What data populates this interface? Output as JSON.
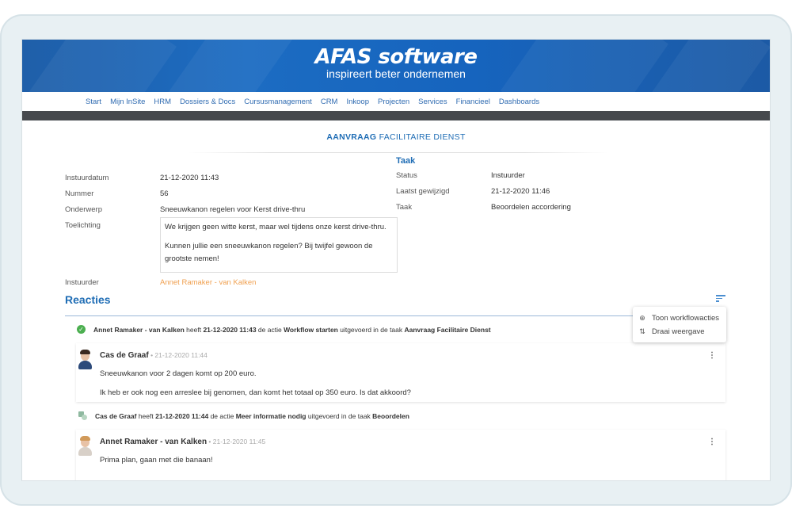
{
  "brand": {
    "name": "AFAS software",
    "tagline": "inspireert beter ondernemen",
    "colors": {
      "primary": "#1c6cc2",
      "nav_text": "#2f6bb1",
      "dark_bar": "#46494d",
      "link_orange": "#f0a050",
      "success": "#4caf50"
    }
  },
  "nav": {
    "items": [
      "Start",
      "Mijn InSite",
      "HRM",
      "Dossiers & Docs",
      "Cursusmanagement",
      "CRM",
      "Inkoop",
      "Projecten",
      "Services",
      "Financieel",
      "Dashboards"
    ]
  },
  "page": {
    "title_bold": "AANVRAAG",
    "title_rest": " FACILITAIRE DIENST"
  },
  "form": {
    "instuurdatum_label": "Instuurdatum",
    "instuurdatum_value": "21-12-2020 11:43",
    "nummer_label": "Nummer",
    "nummer_value": "56",
    "onderwerp_label": "Onderwerp",
    "onderwerp_value": "Sneeuwkanon regelen voor Kerst drive-thru",
    "toelichting_label": "Toelichting",
    "toelichting_p1": "We krijgen geen witte kerst, maar wel tijdens onze kerst drive-thru.",
    "toelichting_p2": "Kunnen jullie een sneeuwkanon regelen? Bij twijfel gewoon de grootste nemen!",
    "instuurder_label": "Instuurder",
    "instuurder_value": "Annet Ramaker - van Kalken"
  },
  "taak": {
    "title": "Taak",
    "status_label": "Status",
    "status_value": "Instuurder",
    "gewijzigd_label": "Laatst gewijzigd",
    "gewijzigd_value": "21-12-2020 11:46",
    "taak_label": "Taak",
    "taak_value": "Beoordelen accordering"
  },
  "reacties": {
    "title": "Reacties",
    "menu": {
      "toon_icon": "circle-plus-icon",
      "toon_label": "Toon workflowacties",
      "draai_icon": "swap-vertical-icon",
      "draai_label": "Draai weergave"
    },
    "action1": {
      "icon": "check-circle-icon",
      "user": "Annet Ramaker - van Kalken",
      "t1": " heeft ",
      "time": "21-12-2020 11:43",
      "t2": " de actie ",
      "action": "Workflow starten",
      "t3": " uitgevoerd in de taak ",
      "task": "Aanvraag Facilitaire Dienst"
    },
    "comment1": {
      "author": "Cas de Graaf",
      "time": " • 21-12-2020 11:44",
      "line1": "Sneeuwkanon voor 2 dagen komt op 200 euro.",
      "line2": "Ik heb er ook nog een arreslee bij genomen, dan komt het totaal op 350 euro. Is dat akkoord?"
    },
    "action2": {
      "icon": "workflow-icon",
      "user": "Cas de Graaf",
      "t1": " heeft ",
      "time": "21-12-2020 11:44",
      "t2": " de actie ",
      "action": "Meer informatie nodig",
      "t3": " uitgevoerd in de taak ",
      "task": "Beoordelen"
    },
    "comment2": {
      "author": "Annet Ramaker - van Kalken",
      "time": " • 21-12-2020 11:45",
      "line1": "Prima plan, gaan met die banaan!"
    }
  }
}
